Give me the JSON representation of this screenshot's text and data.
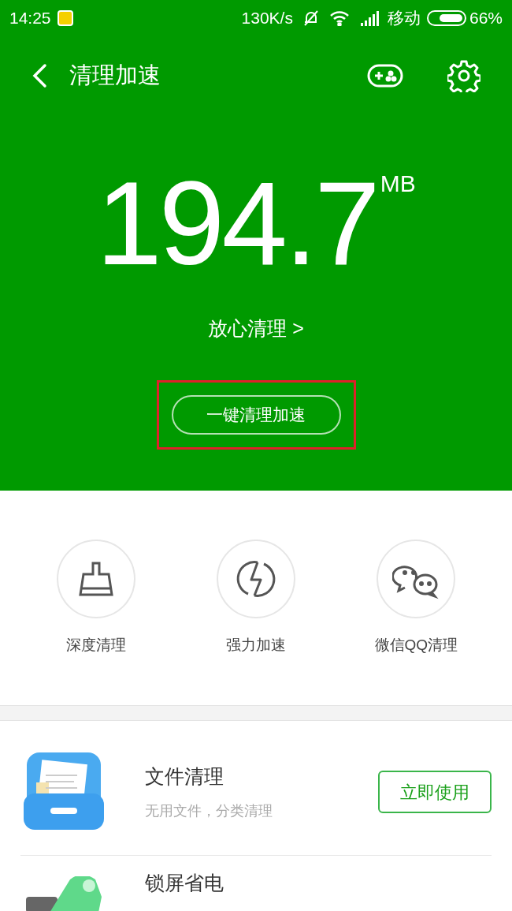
{
  "status_bar": {
    "time": "14:25",
    "speed": "130K/s",
    "carrier": "移动",
    "battery": "66%"
  },
  "header": {
    "title": "清理加速"
  },
  "summary": {
    "amount": "194.7",
    "unit": "MB",
    "link": "放心清理 >",
    "button": {
      "label": "一键清理加速",
      "highlighted": true
    }
  },
  "tools": [
    {
      "kind": "broom",
      "label": "深度清理"
    },
    {
      "kind": "bolt",
      "label": "强力加速"
    },
    {
      "kind": "chat",
      "label": "微信QQ清理"
    }
  ],
  "features": [
    {
      "kind": "doc",
      "title": "文件清理",
      "subtitle": "无用文件，分类清理",
      "button": "立即使用"
    },
    {
      "kind": "battery",
      "title": "锁屏省电"
    }
  ]
}
